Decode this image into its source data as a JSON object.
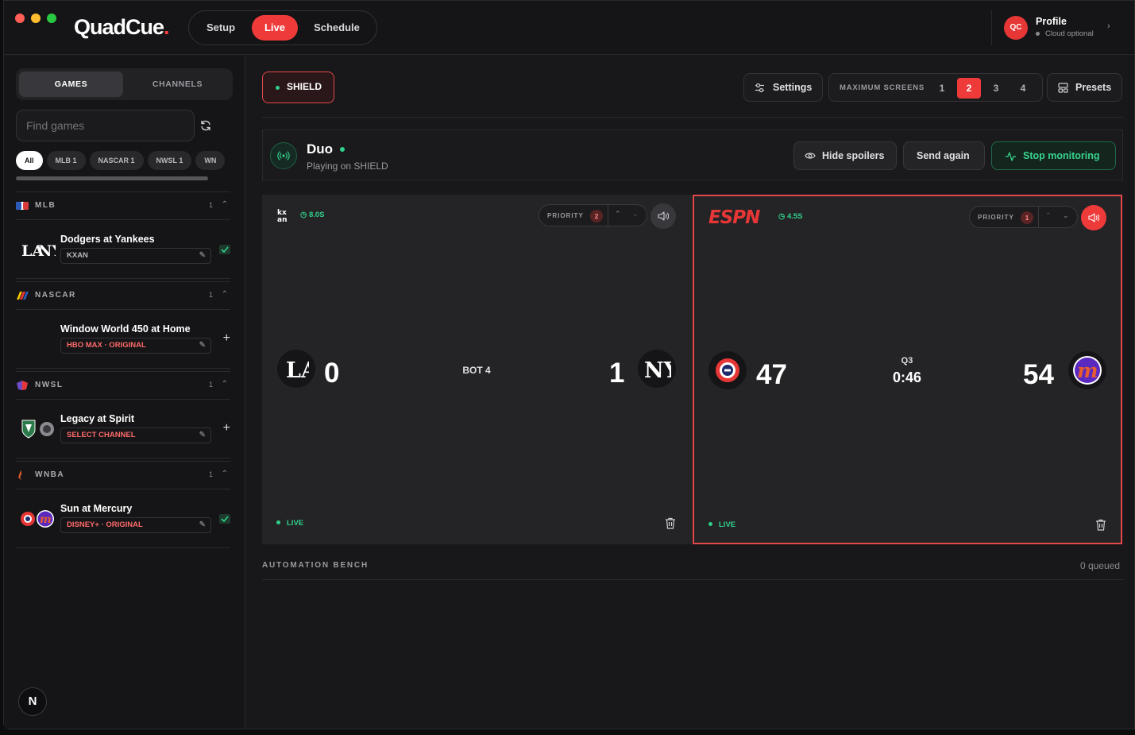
{
  "app": {
    "name": "QuadCue",
    "nav": [
      "Setup",
      "Live",
      "Schedule"
    ],
    "active_nav": "Live",
    "profile": {
      "initials": "QC",
      "name": "Profile",
      "status": "Cloud optional"
    }
  },
  "sidebar": {
    "tabs": [
      "GAMES",
      "CHANNELS"
    ],
    "active_tab": "GAMES",
    "search_placeholder": "Find games",
    "chips": [
      "All",
      "MLB 1",
      "NASCAR 1",
      "NWSL 1",
      "WN"
    ],
    "sections": [
      {
        "name": "MLB",
        "count": "1",
        "game": {
          "title": "Dodgers at Yankees",
          "channel": "KXAN",
          "channel_color": "#b8b8bd",
          "status": "selected"
        }
      },
      {
        "name": "NASCAR",
        "count": "1",
        "game": {
          "title": "Window World 450 at Home",
          "channel": "HBO MAX · ORIGINAL",
          "channel_color": "#ff6a6a",
          "status": "add"
        }
      },
      {
        "name": "NWSL",
        "count": "1",
        "game": {
          "title": "Legacy at Spirit",
          "channel": "SELECT CHANNEL",
          "channel_color": "#ff6a6a",
          "status": "add"
        }
      },
      {
        "name": "WNBA",
        "count": "1",
        "game": {
          "title": "Sun at Mercury",
          "channel": "DISNEY+ · ORIGINAL",
          "channel_color": "#ff6a6a",
          "status": "selected"
        }
      }
    ],
    "footer_button": "N"
  },
  "toolbar": {
    "device": "SHIELD",
    "settings": "Settings",
    "max_screens_label": "MAXIMUM SCREENS",
    "max_screens": [
      "1",
      "2",
      "3",
      "4"
    ],
    "max_screens_active": "2",
    "presets": "Presets"
  },
  "session": {
    "title": "Duo",
    "subtitle": "Playing on SHIELD",
    "hide_spoilers": "Hide spoilers",
    "send_again": "Send again",
    "stop": "Stop monitoring"
  },
  "screens": [
    {
      "brand": "kxan",
      "timer": "8.0S",
      "priority_label": "PRIORITY",
      "priority": "2",
      "away_score": "0",
      "home_score": "1",
      "period": "BOT 4",
      "clock": "",
      "status": "LIVE",
      "audio": "off"
    },
    {
      "brand": "ESPN",
      "timer": "4.5S",
      "priority_label": "PRIORITY",
      "priority": "1",
      "away_score": "47",
      "home_score": "54",
      "period": "Q3",
      "clock": "0:46",
      "status": "LIVE",
      "audio": "on"
    }
  ],
  "bench": {
    "label": "AUTOMATION BENCH",
    "queued": "0 queued"
  },
  "colors": {
    "accent": "#ef3a3a",
    "live": "#31d08a",
    "background": "#18181a"
  }
}
